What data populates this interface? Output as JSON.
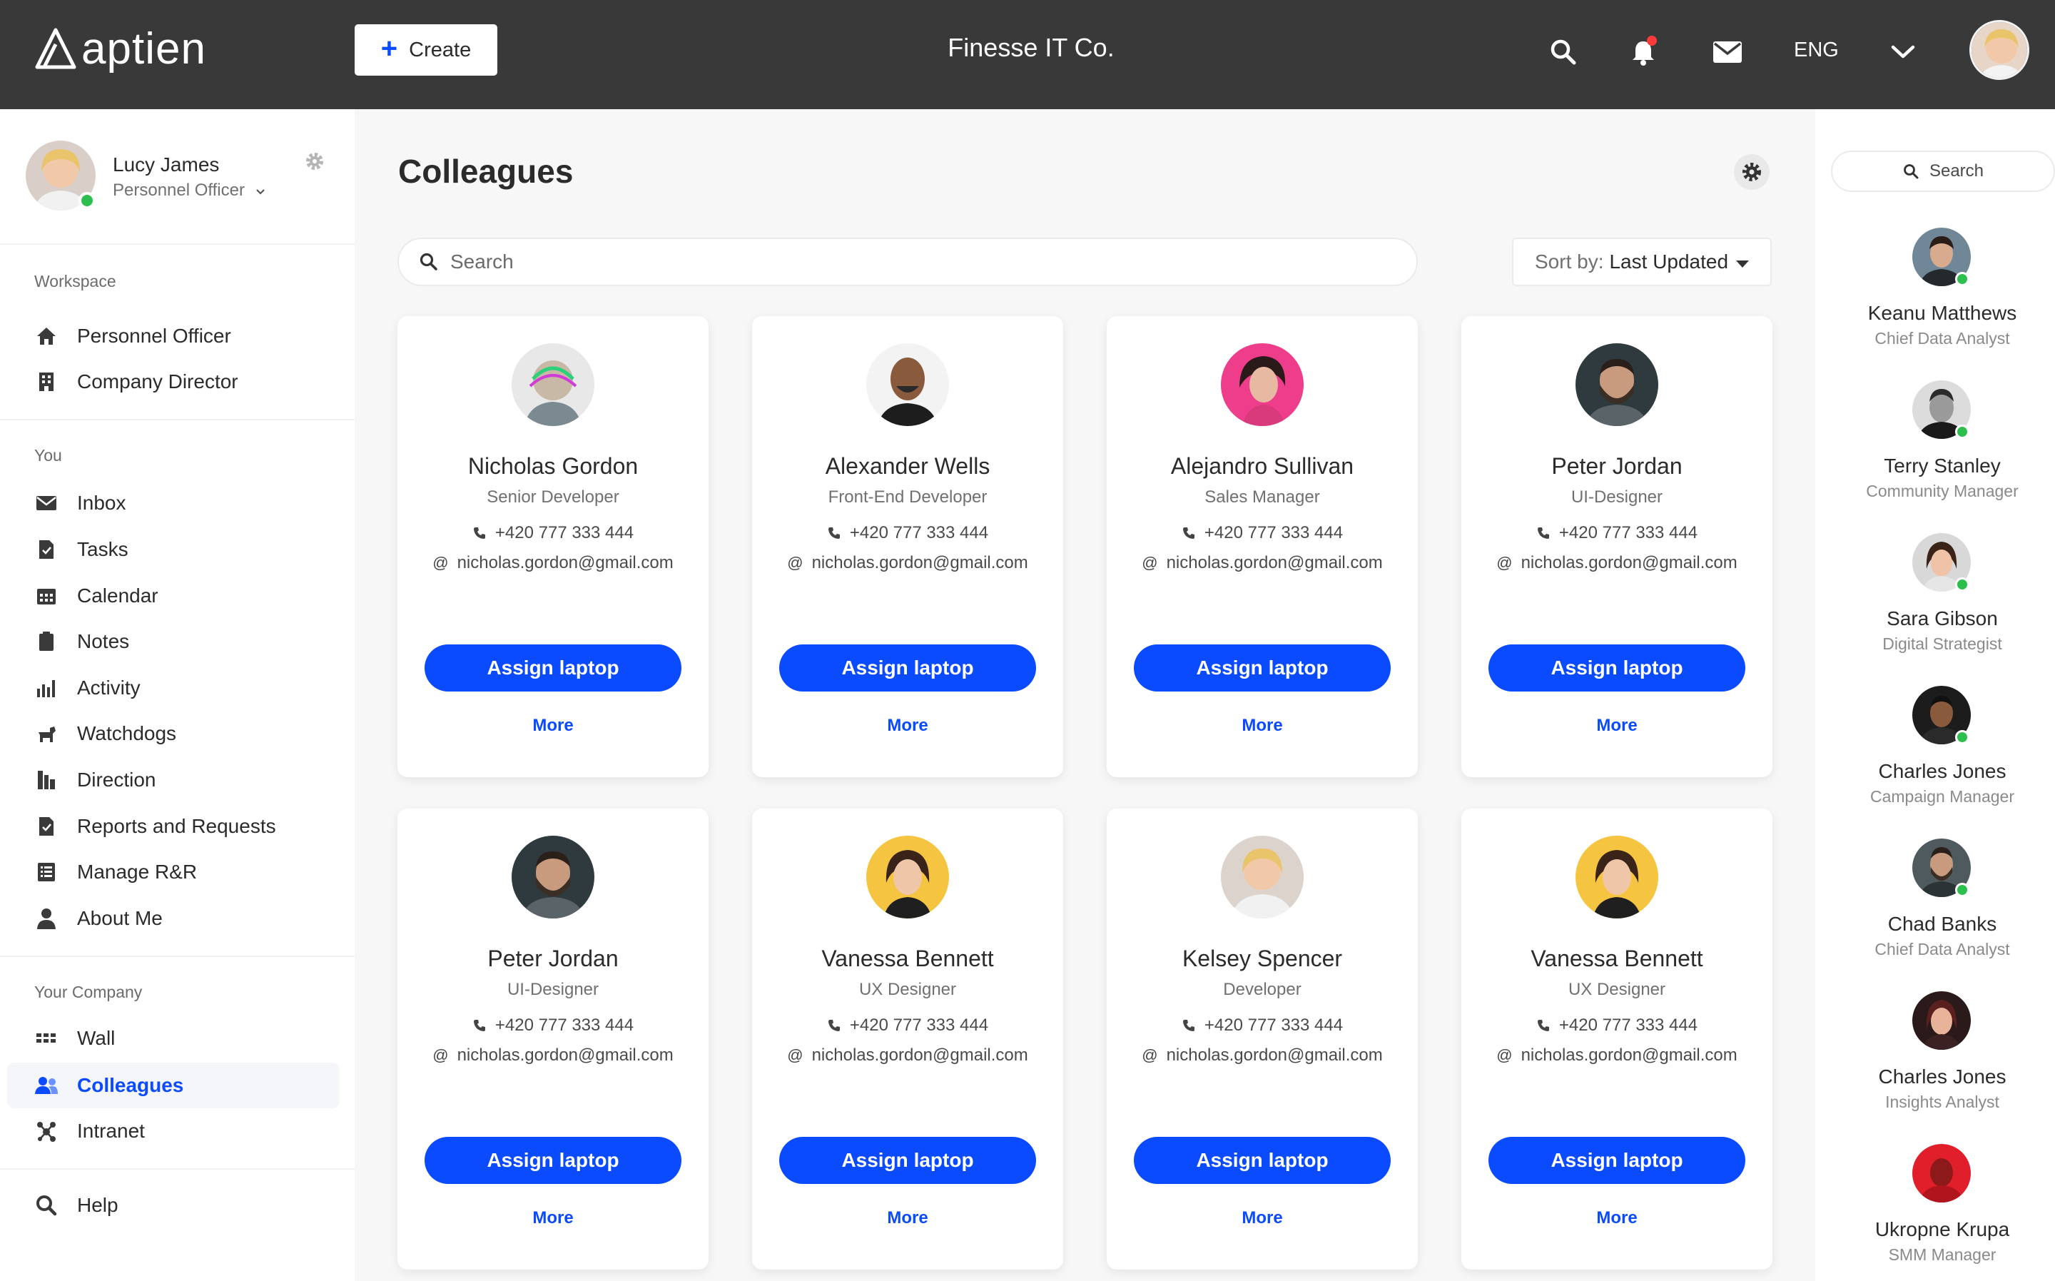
{
  "header": {
    "logo_text": "aptien",
    "create_label": "Create",
    "company": "Finesse IT Co.",
    "language": "ENG",
    "accent": "#0a4bff",
    "bar_color": "#393939"
  },
  "user": {
    "name": "Lucy James",
    "role": "Personnel Officer"
  },
  "sidebar": {
    "workspace_label": "Workspace",
    "workspace_items": [
      {
        "label": "Personnel Officer",
        "icon": "home-icon"
      },
      {
        "label": "Company Director",
        "icon": "building-icon"
      }
    ],
    "you_label": "You",
    "you_items": [
      {
        "label": "Inbox",
        "icon": "mail-icon"
      },
      {
        "label": "Tasks",
        "icon": "task-icon"
      },
      {
        "label": "Calendar",
        "icon": "calendar-icon"
      },
      {
        "label": "Notes",
        "icon": "notes-icon"
      },
      {
        "label": "Activity",
        "icon": "activity-icon"
      },
      {
        "label": "Watchdogs",
        "icon": "dog-icon"
      },
      {
        "label": "Direction",
        "icon": "direction-icon"
      },
      {
        "label": "Reports and Requests",
        "icon": "report-icon"
      },
      {
        "label": "Manage R&R",
        "icon": "list-icon"
      },
      {
        "label": "About Me",
        "icon": "person-icon"
      }
    ],
    "company_label": "Your Company",
    "company_items": [
      {
        "label": "Wall",
        "icon": "wall-icon"
      },
      {
        "label": "Colleagues",
        "icon": "colleagues-icon",
        "active": true
      },
      {
        "label": "Intranet",
        "icon": "intranet-icon"
      }
    ],
    "help_label": "Help"
  },
  "main": {
    "title": "Colleagues",
    "search_placeholder": "Search",
    "sort_prefix": "Sort by:",
    "sort_value": "Last Updated",
    "assign_label": "Assign laptop",
    "more_label": "More",
    "cards": [
      {
        "name": "Nicholas Gordon",
        "role": "Senior Developer",
        "phone": "+420 777 333 444",
        "email": "nicholas.gordon@gmail.com"
      },
      {
        "name": "Alexander Wells",
        "role": "Front-End Developer",
        "phone": "+420 777 333 444",
        "email": "nicholas.gordon@gmail.com"
      },
      {
        "name": "Alejandro Sullivan",
        "role": "Sales Manager",
        "phone": "+420 777 333 444",
        "email": "nicholas.gordon@gmail.com"
      },
      {
        "name": "Peter Jordan",
        "role": "UI-Designer",
        "phone": "+420 777 333 444",
        "email": "nicholas.gordon@gmail.com"
      },
      {
        "name": "Peter Jordan",
        "role": "UI-Designer",
        "phone": "+420 777 333 444",
        "email": "nicholas.gordon@gmail.com"
      },
      {
        "name": "Vanessa Bennett",
        "role": "UX Designer",
        "phone": "+420 777 333 444",
        "email": "nicholas.gordon@gmail.com"
      },
      {
        "name": "Kelsey Spencer",
        "role": "Developer",
        "phone": "+420 777 333 444",
        "email": "nicholas.gordon@gmail.com"
      },
      {
        "name": "Vanessa Bennett",
        "role": "UX Designer",
        "phone": "+420 777 333 444",
        "email": "nicholas.gordon@gmail.com"
      }
    ]
  },
  "rail": {
    "search_placeholder": "Search",
    "people": [
      {
        "name": "Keanu Matthews",
        "role": "Chief Data Analyst",
        "online": true
      },
      {
        "name": "Terry Stanley",
        "role": "Community Manager",
        "online": true
      },
      {
        "name": "Sara Gibson",
        "role": "Digital Strategist",
        "online": true
      },
      {
        "name": "Charles Jones",
        "role": "Campaign Manager",
        "online": true
      },
      {
        "name": "Chad Banks",
        "role": "Chief Data Analyst",
        "online": true
      },
      {
        "name": "Charles Jones",
        "role": "Insights Analyst",
        "online": false
      },
      {
        "name": "Ukropne Krupa",
        "role": "SMM Manager",
        "online": false
      }
    ]
  }
}
